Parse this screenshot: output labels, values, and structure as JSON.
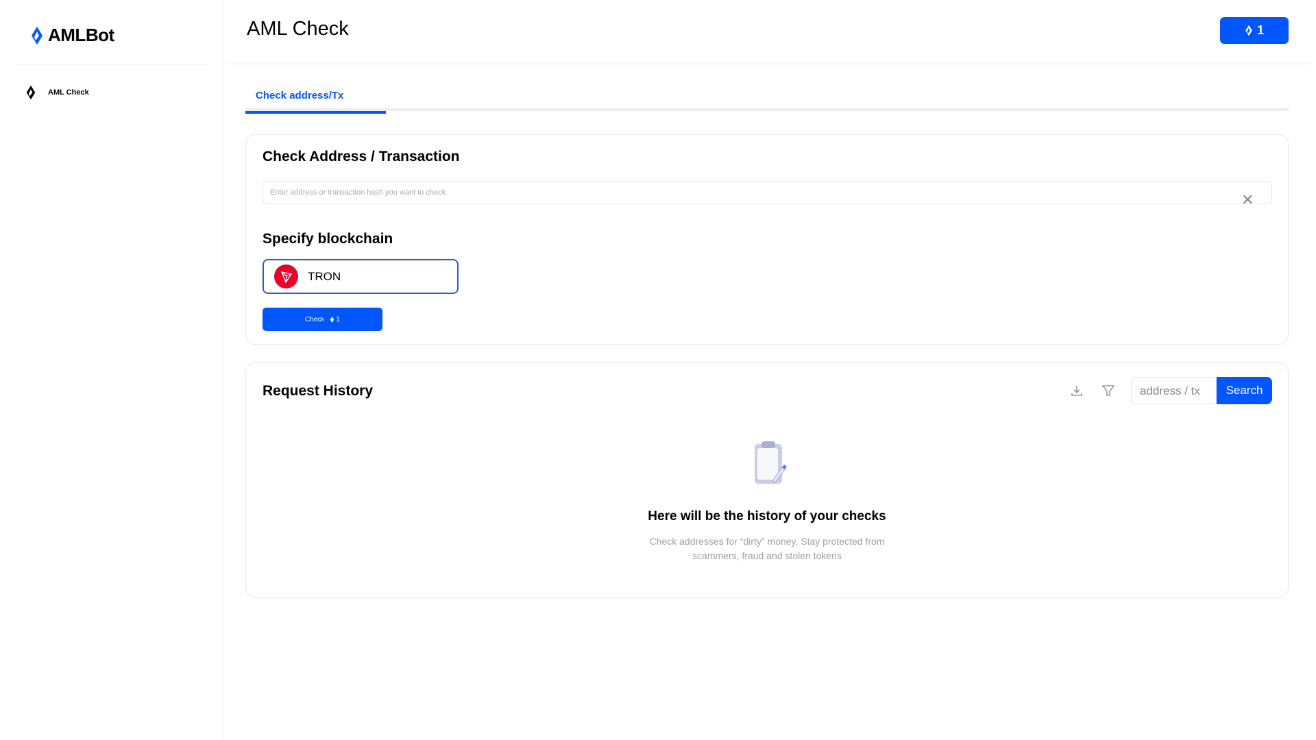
{
  "brand": {
    "name": "AMLBot"
  },
  "sidebar": {
    "items": [
      {
        "label": "AML Check"
      }
    ]
  },
  "header": {
    "title": "AML Check",
    "credits": "1"
  },
  "tabs": [
    {
      "label": "Check address/Tx"
    }
  ],
  "check_card": {
    "title": "Check Address / Transaction",
    "input_placeholder": "Enter address or transaction hash you want to check",
    "blockchain_title": "Specify blockchain",
    "selected_chain": "TRON",
    "check_label": "Check",
    "check_cost": "1"
  },
  "history": {
    "title": "Request History",
    "search_placeholder": "address / tx",
    "search_label": "Search",
    "empty_title": "Here will be the history of your checks",
    "empty_line1": "Check addresses for “dirty” money. Stay protected from",
    "empty_line2": "scammers, fraud and stolen tokens"
  },
  "colors": {
    "accent": "#0057ff",
    "tron": "#eb0029"
  }
}
